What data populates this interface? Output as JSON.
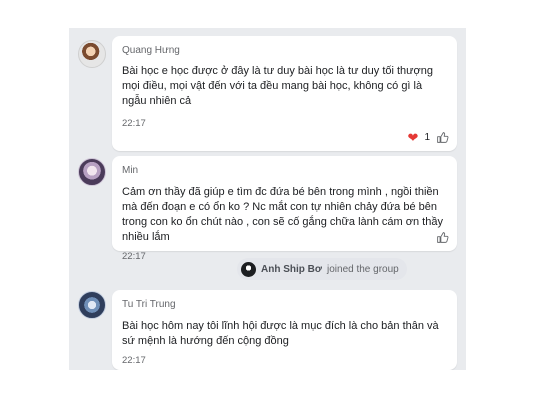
{
  "messages": [
    {
      "sender": "Quang Hưng",
      "text": "Bài học e học được ở đây là tư duy bài học là tư duy tối thượng mọi điều, mọi vật đến với ta đều mang bài học, không có gì là ngẫu nhiên cả",
      "time": "22:17",
      "reaction_count": "1"
    },
    {
      "sender": "Min",
      "text": "Cảm ơn thầy đã giúp e tìm đc đứa bé bên trong mình , ngồi thiền mà đến đoạn e có ổn ko ? Nc mắt con tự nhiên chảy đứa bé bên trong con ko ổn chút nào , con sẽ cố gắng chữa lành cám ơn thầy nhiều lắm",
      "time": "22:17"
    },
    {
      "sender": "Tu Tri Trung",
      "text": "Bài học hôm nay tôi lĩnh hội được là mục đích là cho bản thân và sứ mệnh là hướng đến cộng đồng",
      "time": "22:17"
    }
  ],
  "join_event": {
    "name": "Anh Ship Bơ",
    "text": "joined the group"
  },
  "icons": {
    "heart": "heart-icon",
    "like": "thumbs-up-icon"
  },
  "colors": {
    "heart": "#e53935",
    "panel_bg": "#e9ebee"
  }
}
